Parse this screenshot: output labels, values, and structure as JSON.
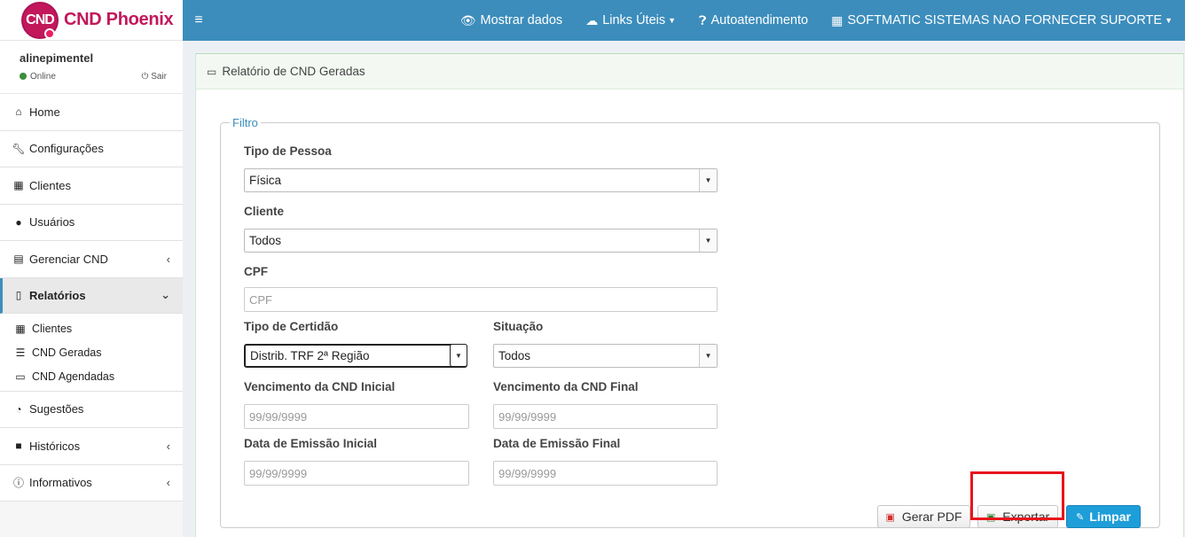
{
  "brand": {
    "logo_text": "CND",
    "name": "CND Phoenix"
  },
  "user": {
    "name": "alinepimentel",
    "status": "Online",
    "logout": "Sair"
  },
  "menu": [
    {
      "label": "Home",
      "icon": "home-icon"
    },
    {
      "label": "Configurações",
      "icon": "wrench-icon"
    },
    {
      "label": "Clientes",
      "icon": "building-icon"
    },
    {
      "label": "Usuários",
      "icon": "user-icon"
    },
    {
      "label": "Gerenciar CND",
      "icon": "calendar-icon",
      "arrow": "‹"
    },
    {
      "label": "Relatórios",
      "icon": "document-icon",
      "arrow": "⌄",
      "active": true
    },
    {
      "label": "Sugestões",
      "icon": "comments-icon"
    },
    {
      "label": "Históricos",
      "icon": "archive-icon",
      "arrow": "‹"
    },
    {
      "label": "Informativos",
      "icon": "info-icon",
      "arrow": "‹"
    }
  ],
  "submenu": [
    {
      "label": "Clientes",
      "icon": "building-icon"
    },
    {
      "label": "CND Geradas",
      "icon": "list-icon"
    },
    {
      "label": "CND Agendadas",
      "icon": "calendar-icon"
    }
  ],
  "topbar": {
    "toggle": "≡",
    "mostrar": "Mostrar dados",
    "links": "Links Úteis",
    "auto": "Autoatendimento",
    "company": "SOFTMATIC SISTEMAS NAO FORNECER SUPORTE"
  },
  "box": {
    "title": "Relatório de CND Geradas"
  },
  "filtro": {
    "legend": "Filtro",
    "tipo_pessoa_label": "Tipo de Pessoa",
    "tipo_pessoa_value": "Física",
    "cliente_label": "Cliente",
    "cliente_value": "Todos",
    "cpf_label": "CPF",
    "cpf_placeholder": "CPF",
    "tipo_certidao_label": "Tipo de Certidão",
    "tipo_certidao_value": "Distrib. TRF 2ª Região",
    "situacao_label": "Situação",
    "situacao_value": "Todos",
    "venc_inicial_label": "Vencimento da CND Inicial",
    "venc_inicial_placeholder": "99/99/9999",
    "venc_final_label": "Vencimento da CND Final",
    "venc_final_placeholder": "99/99/9999",
    "emissao_inicial_label": "Data de Emissão Inicial",
    "emissao_inicial_placeholder": "99/99/9999",
    "emissao_final_label": "Data de Emissão Final",
    "emissao_final_placeholder": "99/99/9999"
  },
  "buttons": {
    "pdf": "Gerar PDF",
    "exportar": "Exportar",
    "limpar": "Limpar"
  },
  "colors": {
    "topbar": "#3c8dbc",
    "brand": "#c2185b",
    "limpar": "#1e9ed8",
    "highlight": "#e8141b",
    "legend": "#3c8dbc"
  }
}
